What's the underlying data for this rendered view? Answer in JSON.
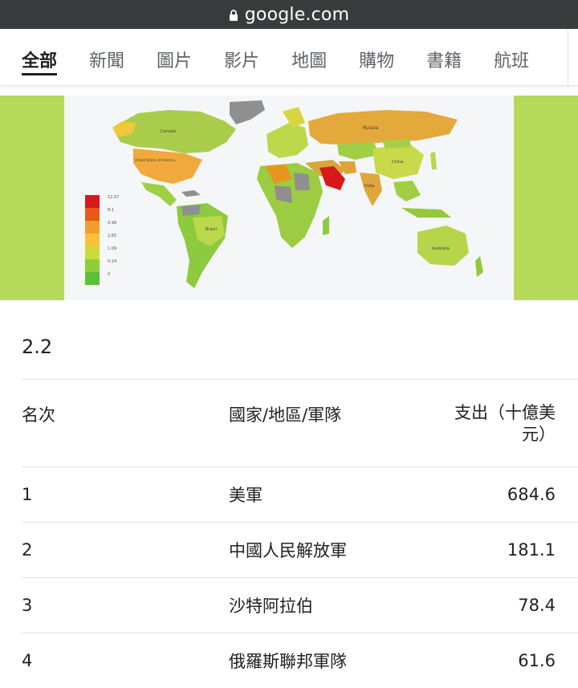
{
  "url_bar": {
    "domain": "google.com"
  },
  "tabs": [
    {
      "label": "全部",
      "active": true
    },
    {
      "label": "新聞"
    },
    {
      "label": "圖片"
    },
    {
      "label": "影片"
    },
    {
      "label": "地圖"
    },
    {
      "label": "購物"
    },
    {
      "label": "書籍"
    },
    {
      "label": "航班"
    }
  ],
  "map": {
    "country_labels": [
      "Russia",
      "United States of America",
      "China",
      "India",
      "Brazil",
      "Australia",
      "Canada"
    ],
    "legend_values": [
      "12.07",
      "8.1",
      "4.98",
      "2.65",
      "1.09",
      "0.24",
      "0"
    ],
    "legend_colors": [
      "#d7191c",
      "#e8591a",
      "#f29e2e",
      "#f5c23a",
      "#c9dd3a",
      "#8fcd3a",
      "#5cbf38"
    ],
    "band_color": "#b7d95b"
  },
  "section_number": "2.2",
  "table": {
    "headers": {
      "rank": "名次",
      "country": "國家/地區/軍隊",
      "spend": "支出（十億美元）"
    },
    "rows": [
      {
        "rank": "1",
        "country": "美軍",
        "spend": "684.6"
      },
      {
        "rank": "2",
        "country": "中國人民解放軍",
        "spend": "181.1"
      },
      {
        "rank": "3",
        "country": "沙特阿拉伯",
        "spend": "78.4"
      },
      {
        "rank": "4",
        "country": "俄羅斯聯邦軍隊",
        "spend": "61.6"
      }
    ]
  }
}
